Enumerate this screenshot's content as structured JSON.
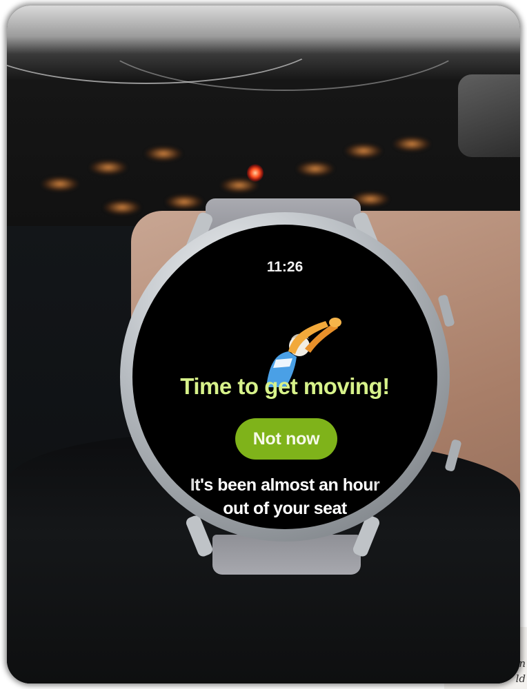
{
  "watch": {
    "time": "11:26",
    "title": "Time to get moving!",
    "button_label": "Not now",
    "message_line_1": "It's been almost an hour",
    "message_line_2": "out of your seat"
  },
  "paper_corner": {
    "text_line_1": "n",
    "text_line_2": "ld"
  },
  "colors": {
    "title_text": "#d7f28a",
    "button_bg": "#7fb31a",
    "screen_bg": "#000000"
  },
  "icons": [
    "stretching-person-illustration"
  ]
}
